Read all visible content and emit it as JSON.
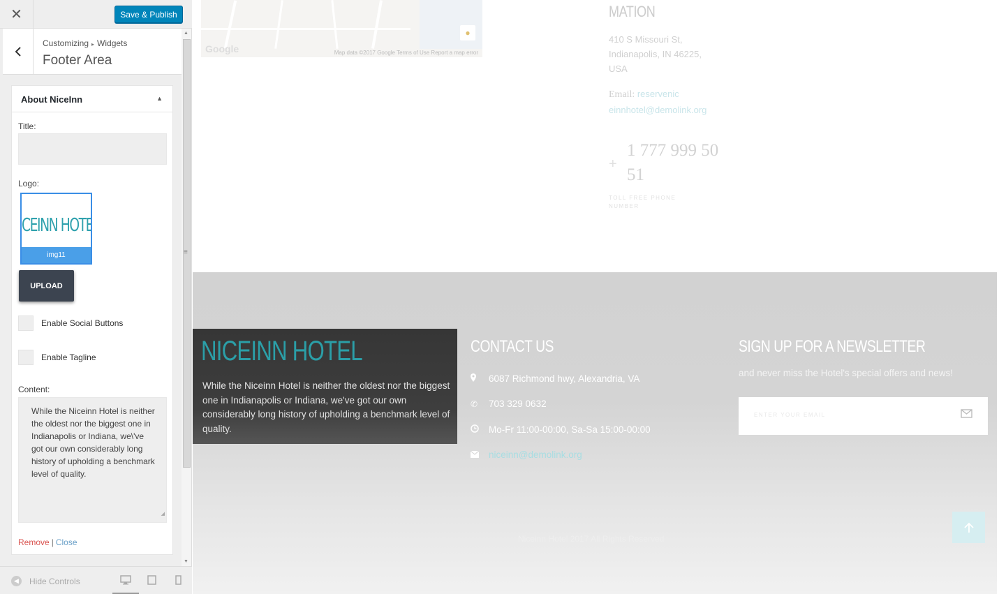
{
  "customizer": {
    "close_glyph": "✕",
    "publish_label": "Save & Publish",
    "breadcrumb": [
      "Customizing",
      "Widgets"
    ],
    "breadcrumb_sep": "▸",
    "section_title": "Footer Area",
    "widget": {
      "title": "About NiceInn",
      "title_label": "Title:",
      "title_value": "",
      "logo_label": "Logo:",
      "logo_image_text": "CEINN HOTE",
      "logo_caption": "img11",
      "upload_label": "UPLOAD",
      "checkbox_social": "Enable Social Buttons",
      "checkbox_tagline": "Enable Tagline",
      "content_label": "Content:",
      "content_value": "While the Niceinn Hotel is neither the oldest nor the biggest one in Indianapolis or Indiana, we\\'ve got our own considerably long history of upholding a benchmark level of quality.",
      "remove_label": "Remove",
      "pipe": "|",
      "close_label": "Close"
    },
    "hide_controls_label": "Hide Controls",
    "devices": [
      "desktop-icon",
      "tablet-icon",
      "mobile-icon"
    ],
    "accent": "#0085ba"
  },
  "preview": {
    "map": {
      "attribution": "Map data ©2017 Google   Terms of Use   Report a map error",
      "google_mark": "Google"
    },
    "contact_info": {
      "heading": "MATION",
      "address": "410 S Missouri St, Indianapolis, IN 46225, USA",
      "email_label": "Email:",
      "email_value": "reservenic einnhotel@demolink.org",
      "plus": "+",
      "phone": "1 777 999 50 51",
      "tollfree": "TOLL FREE PHONE NUMBER"
    },
    "footer": {
      "brand": "NICEINN HOTEL",
      "about": "While the Niceinn Hotel is neither the oldest nor the biggest one in Indianapolis or Indiana, we've got our own considerably long history of upholding a benchmark level of quality.",
      "contact_heading": "CONTACT US",
      "address": "6087 Richmond hwy, Alexandria, VA",
      "phone": "703 329 0632",
      "hours": "Mo-Fr 11:00-00:00, Sa-Sa 15:00-00:00",
      "email": "niceinn@demolink.org",
      "newsletter_heading": "SIGN UP FOR A NEWSLETTER",
      "newsletter_sub": "and never miss the Hotel's special offers and news!",
      "email_placeholder": "ENTER YOUR EMAIL",
      "copyright": "Niceinn Hotel 2017 All Rights Reserved",
      "brand_color": "#2b9fa8"
    }
  }
}
